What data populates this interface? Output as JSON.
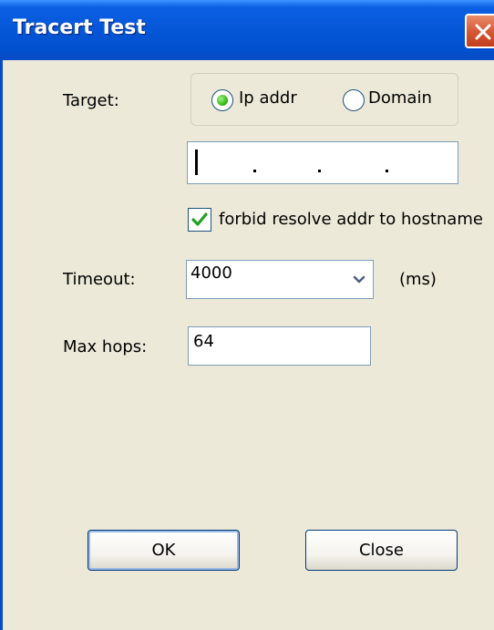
{
  "window": {
    "title": "Tracert Test",
    "close_icon": "close-icon"
  },
  "form": {
    "target_label": "Target:",
    "radio_ip_label": "Ip addr",
    "radio_domain_label": "Domain",
    "selected_target_mode": "Ip addr",
    "ip_value": "",
    "forbid_resolve_label": "forbid resolve addr to hostname",
    "forbid_resolve_checked": true,
    "timeout_label": "Timeout:",
    "timeout_value": "4000",
    "timeout_unit": "(ms)",
    "max_hops_label": "Max hops:",
    "max_hops_value": "64"
  },
  "buttons": {
    "ok_label": "OK",
    "close_label": "Close"
  },
  "colors": {
    "titlebar": "#0758d9",
    "close_button": "#d65a36",
    "radio_selected": "#3ec21e",
    "checkmark": "#21a121",
    "window_bg": "#ece9d8",
    "field_border": "#7f9db9"
  }
}
